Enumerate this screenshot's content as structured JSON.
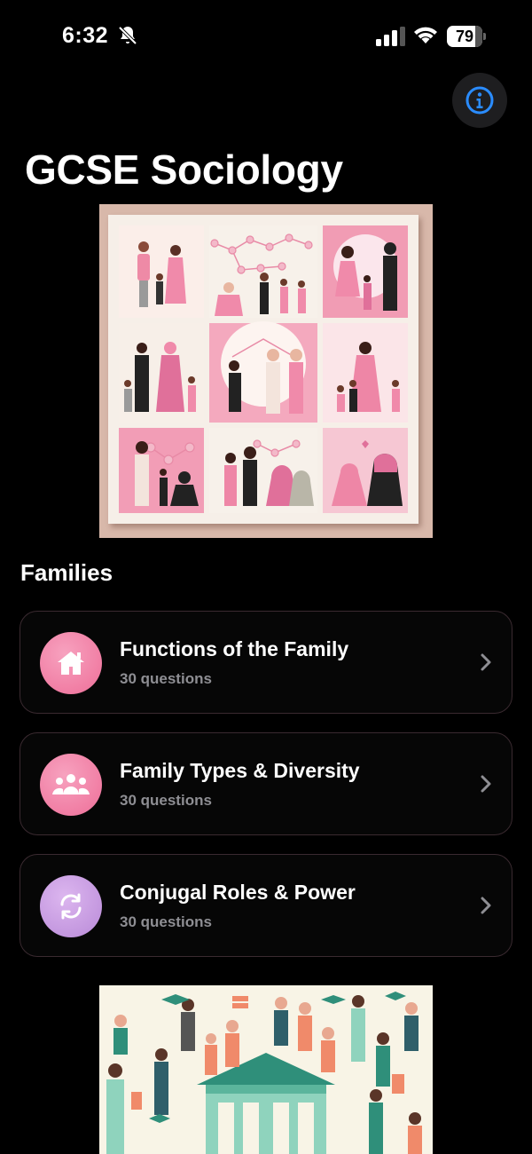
{
  "status_bar": {
    "time": "6:32",
    "battery": "79"
  },
  "header": {
    "title": "GCSE Sociology"
  },
  "section": {
    "title": "Families"
  },
  "topics": [
    {
      "title": "Functions of the Family",
      "subtitle": "30 questions",
      "icon": "house-icon",
      "color": "#f06b9a"
    },
    {
      "title": "Family Types & Diversity",
      "subtitle": "30 questions",
      "icon": "people-group-icon",
      "color": "#f06b9a"
    },
    {
      "title": "Conjugal Roles & Power",
      "subtitle": "30 questions",
      "icon": "cycle-arrows-icon",
      "color": "#c79ae0"
    }
  ],
  "colors": {
    "accent": "#2a8cff",
    "pink": "#f06b9a",
    "lavender": "#c79ae0",
    "muted": "#8e8e93"
  }
}
